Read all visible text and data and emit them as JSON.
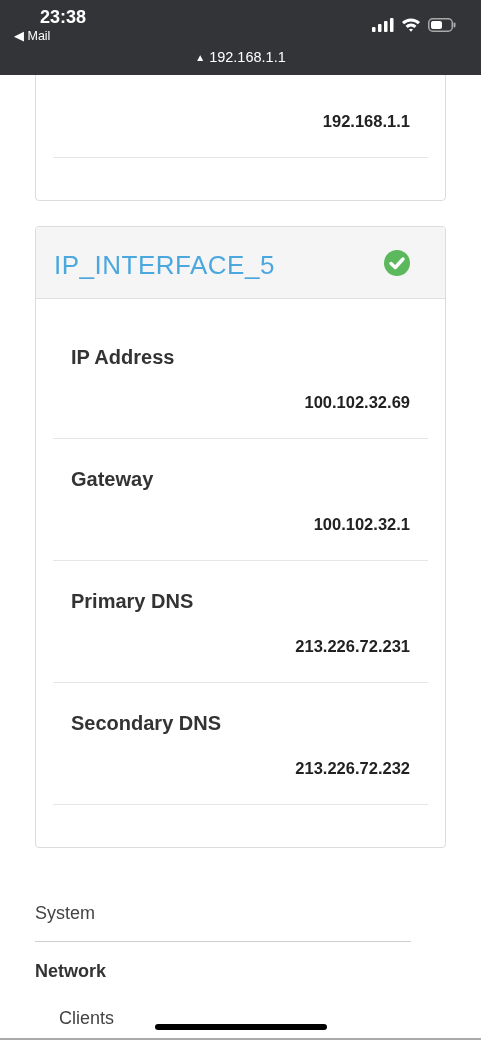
{
  "status_bar": {
    "time": "23:38",
    "back_link": "◀ Mail",
    "url_icon": "▲",
    "url": "192.168.1.1"
  },
  "interfaces": [
    {
      "rows": [
        {
          "value": "192.168.1.1"
        }
      ]
    },
    {
      "title": "IP_INTERFACE_5",
      "connected": true,
      "rows": [
        {
          "label": "IP Address",
          "value": "100.102.32.69"
        },
        {
          "label": "Gateway",
          "value": "100.102.32.1"
        },
        {
          "label": "Primary DNS",
          "value": "213.226.72.231"
        },
        {
          "label": "Secondary DNS",
          "value": "213.226.72.232"
        }
      ]
    }
  ],
  "nav": [
    {
      "label": "System",
      "kind": "section"
    },
    {
      "label": "Network",
      "kind": "group"
    },
    {
      "label": "Clients",
      "kind": "item"
    }
  ]
}
